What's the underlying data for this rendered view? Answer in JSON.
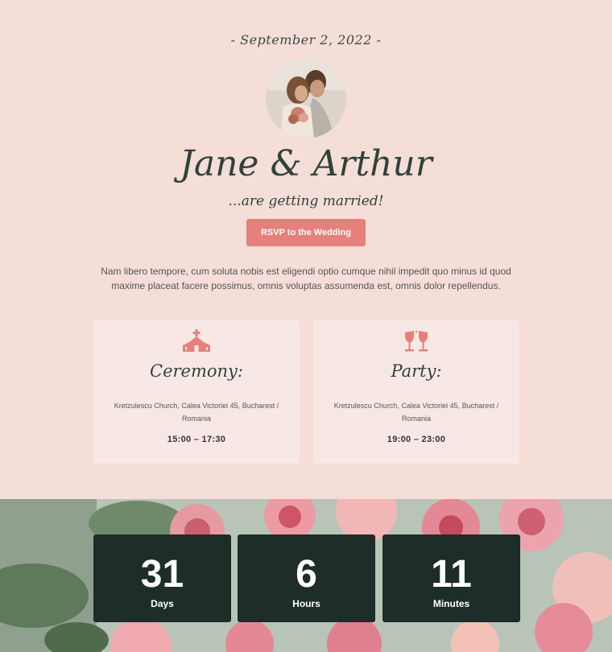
{
  "hero": {
    "date": "- September 2, 2022 -",
    "names": "Jane & Arthur",
    "tagline": "...are getting married!",
    "rsvp_label": "RSVP to the Wedding",
    "intro": "Nam libero tempore, cum soluta nobis est eligendi optio cumque nihil impedit quo minus id quod maxime placeat facere possimus, omnis voluptas assumenda est, omnis dolor repellendus."
  },
  "events": [
    {
      "title": "Ceremony:",
      "icon": "church-icon",
      "address": "Kretzulescu Church, Calea Victoriei 45, Bucharest / Romania",
      "time": "15:00 – 17:30"
    },
    {
      "title": "Party:",
      "icon": "toast-glasses-icon",
      "address": "Kretzulescu Church, Calea Victoriei 45, Bucharest / Romania",
      "time": "19:00 – 23:00"
    }
  ],
  "countdown": [
    {
      "value": "31",
      "unit": "Days"
    },
    {
      "value": "6",
      "unit": "Hours"
    },
    {
      "value": "11",
      "unit": "Minutes"
    }
  ],
  "colors": {
    "background": "#f5ddd8",
    "card": "#f8e8e5",
    "accent": "#e5807a",
    "dark": "#1e2d27",
    "heading": "#2f4339"
  }
}
